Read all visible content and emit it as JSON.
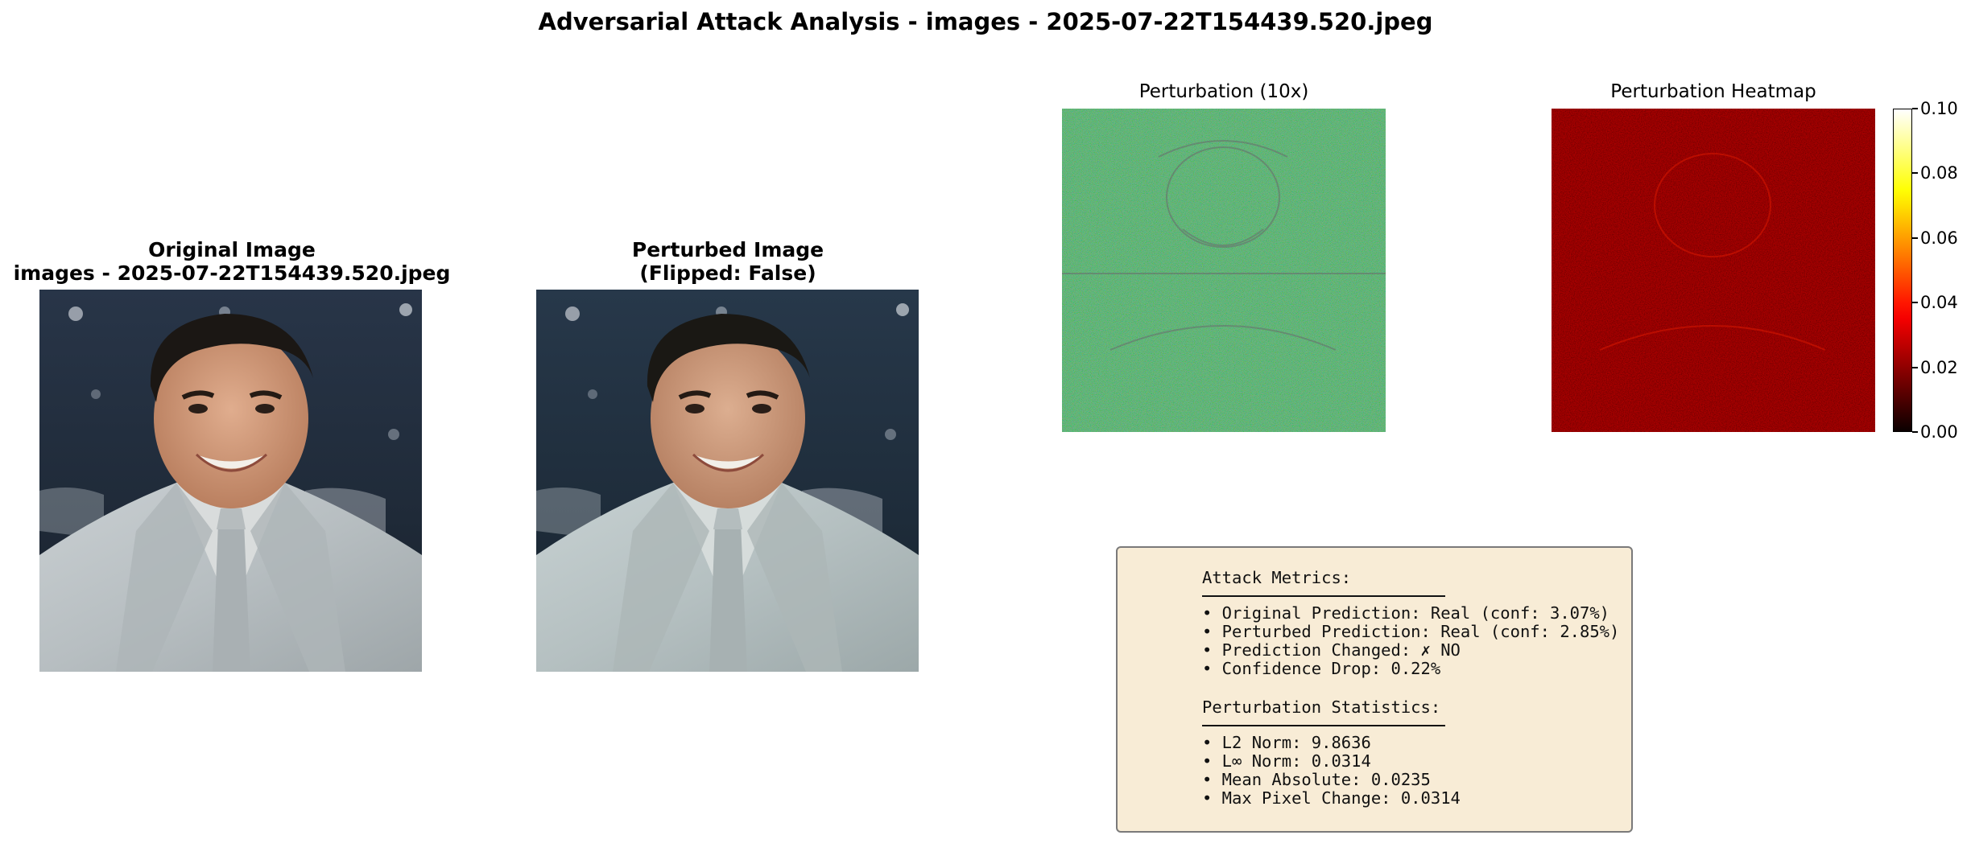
{
  "figure": {
    "title": "Adversarial Attack Analysis - images - 2025-07-22T154439.520.jpeg"
  },
  "panels": {
    "original": {
      "title_line1": "Original Image",
      "title_line2": "images - 2025-07-22T154439.520.jpeg"
    },
    "perturbed": {
      "title_line1": "Perturbed Image",
      "title_line2": "(Flipped: False)"
    },
    "perturbation": {
      "title": "Perturbation (10x)"
    },
    "heatmap": {
      "title": "Perturbation Heatmap"
    }
  },
  "metrics": {
    "attack_header": "Attack Metrics:",
    "attack_items": [
      "• Original Prediction: Real (conf: 3.07%)",
      "• Perturbed Prediction: Real (conf: 2.85%)",
      "• Prediction Changed: ✗ NO",
      "• Confidence Drop: 0.22%"
    ],
    "stats_header": "Perturbation Statistics:",
    "stats_items": [
      "• L2 Norm: 9.8636",
      "• L∞ Norm: 0.0314",
      "• Mean Absolute: 0.0235",
      "• Max Pixel Change: 0.0314"
    ]
  },
  "chart_data": {
    "type": "heatmap",
    "title": "Perturbation Heatmap",
    "colormap": "hot",
    "colorbar": {
      "vmin": 0.0,
      "vmax": 0.1,
      "ticks": [
        0.0,
        0.02,
        0.04,
        0.06,
        0.08,
        0.1
      ],
      "tick_labels": [
        "0.00",
        "0.02",
        "0.04",
        "0.06",
        "0.08",
        "0.10"
      ]
    },
    "typical_value": 0.0235,
    "max_value": 0.0314
  },
  "colors": {
    "metrics_background": "#f8ecd6",
    "metrics_border": "#7a7a7a",
    "perturbation_base": "#3fb260",
    "heatmap_base": "#c80000"
  }
}
